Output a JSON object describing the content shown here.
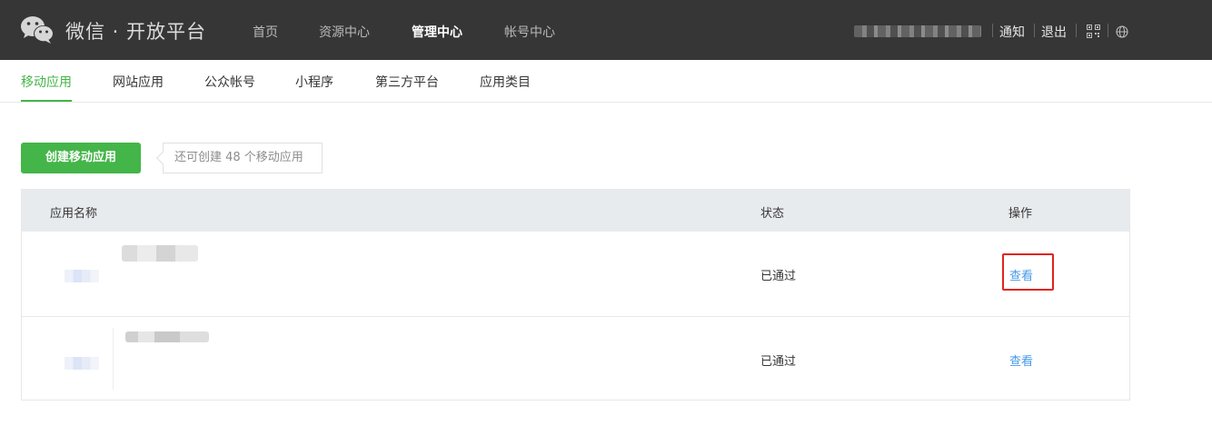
{
  "header": {
    "brand": "微信 · 开放平台",
    "nav": [
      {
        "label": "首页",
        "active": false
      },
      {
        "label": "资源中心",
        "active": false
      },
      {
        "label": "管理中心",
        "active": true
      },
      {
        "label": "帐号中心",
        "active": false
      }
    ],
    "links": {
      "notify": "通知",
      "logout": "退出"
    },
    "icons": {
      "logo": "wechat-logo-icon",
      "qr": "qr-code-icon",
      "lang": "globe-icon"
    }
  },
  "subtabs": [
    {
      "label": "移动应用",
      "active": true
    },
    {
      "label": "网站应用",
      "active": false
    },
    {
      "label": "公众帐号",
      "active": false
    },
    {
      "label": "小程序",
      "active": false
    },
    {
      "label": "第三方平台",
      "active": false
    },
    {
      "label": "应用类目",
      "active": false
    }
  ],
  "toolbar": {
    "create_label": "创建移动应用",
    "hint": "还可创建 48 个移动应用"
  },
  "table": {
    "headers": {
      "name": "应用名称",
      "status": "状态",
      "action": "操作"
    },
    "rows": [
      {
        "status": "已通过",
        "action": "查看"
      },
      {
        "status": "已通过",
        "action": "查看"
      }
    ]
  },
  "colors": {
    "accent": "#44b549",
    "link": "#459ae9",
    "header_bg": "#363636",
    "highlight": "#e0241d"
  }
}
